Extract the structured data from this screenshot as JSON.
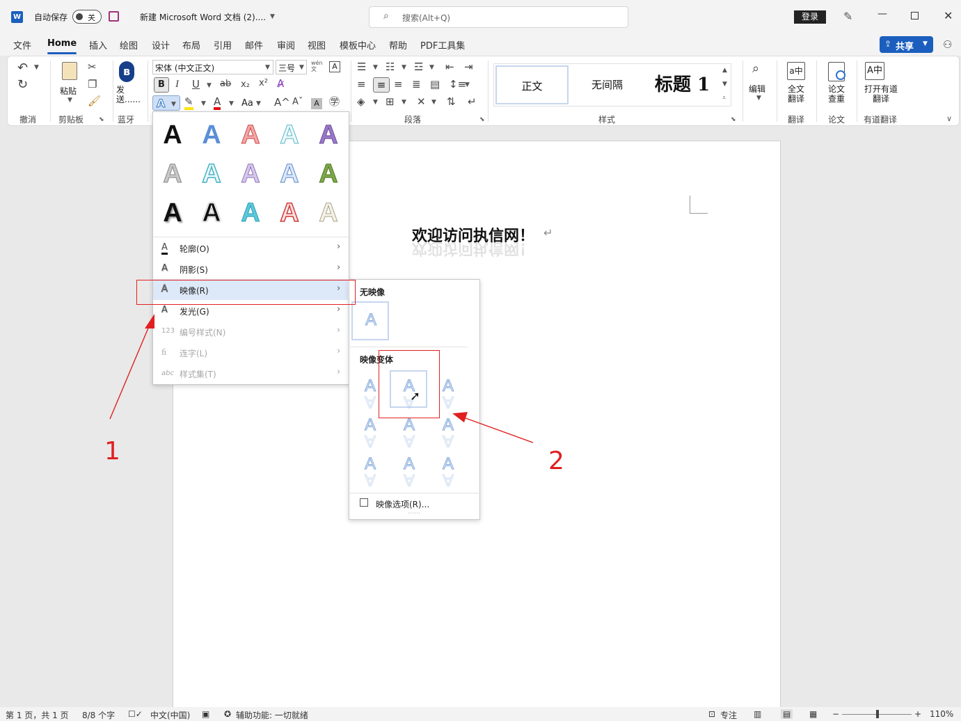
{
  "titlebar": {
    "autosave_label": "自动保存",
    "autosave_state": "关",
    "doc_title": "新建 Microsoft Word 文档 (2)....",
    "search_placeholder": "搜索(Alt+Q)",
    "login_label": "登录"
  },
  "tabs": [
    "文件",
    "Home",
    "插入",
    "绘图",
    "设计",
    "布局",
    "引用",
    "邮件",
    "审阅",
    "视图",
    "模板中心",
    "帮助",
    "PDF工具集"
  ],
  "share_label": "共享",
  "ribbon": {
    "undo_group": "撤消",
    "clipboard": {
      "paste": "粘贴",
      "group": "剪贴板"
    },
    "bluetooth": {
      "send": "发送......",
      "group": "蓝牙"
    },
    "font": {
      "name": "宋体 (中文正文)",
      "size": "三号",
      "wen_label": "wén 文",
      "case_label": "Aa"
    },
    "paragraph_group": "段落",
    "styles": {
      "items": [
        "正文",
        "无间隔",
        "标题 1"
      ],
      "group": "样式"
    },
    "edit_label": "编辑",
    "translate": {
      "full": "全文翻译",
      "group": "翻译"
    },
    "paper": {
      "check": "论文查重",
      "group": "论文"
    },
    "youdao": {
      "open": "打开有道翻译",
      "group": "有道翻译"
    }
  },
  "document": {
    "text": "欢迎访问执信网！",
    "para_mark": "↵"
  },
  "effects_menu": {
    "items": [
      {
        "label": "轮廓(O)",
        "icon": "outline-icon",
        "enabled": true
      },
      {
        "label": "阴影(S)",
        "icon": "shadow-icon",
        "enabled": true
      },
      {
        "label": "映像(R)",
        "icon": "reflection-icon",
        "enabled": true
      },
      {
        "label": "发光(G)",
        "icon": "glow-icon",
        "enabled": true
      },
      {
        "label": "编号样式(N)",
        "icon": "123",
        "enabled": false
      },
      {
        "label": "连字(L)",
        "icon": "ligature-icon",
        "enabled": false
      },
      {
        "label": "样式集(T)",
        "icon": "abc",
        "enabled": false
      }
    ]
  },
  "reflection_menu": {
    "none_header": "无映像",
    "variants_header": "映像变体",
    "options_label": "映像选项(R)..."
  },
  "annotations": {
    "label1": "1",
    "label2": "2"
  },
  "statusbar": {
    "page": "第 1 页，共 1 页",
    "words": "8/8 个字",
    "language": "中文(中国)",
    "accessibility": "辅助功能: 一切就绪",
    "focus": "专注",
    "zoom": "110%"
  }
}
